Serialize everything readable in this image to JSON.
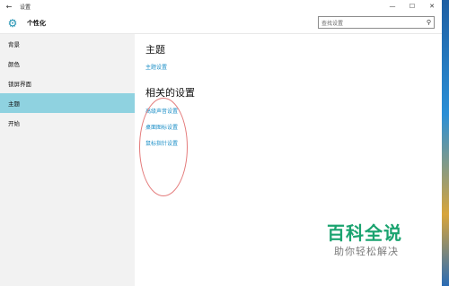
{
  "window": {
    "title": "设置",
    "back_icon": "back-arrow-icon",
    "controls": [
      "minimize-icon",
      "maximize-icon",
      "close-icon"
    ]
  },
  "header": {
    "title": "个性化",
    "icon": "gear-icon",
    "search_placeholder": "查找设置"
  },
  "sidebar": {
    "items": [
      {
        "label": "背景",
        "active": false
      },
      {
        "label": "颜色",
        "active": false
      },
      {
        "label": "锁屏界面",
        "active": false
      },
      {
        "label": "主题",
        "active": true
      },
      {
        "label": "开始",
        "active": false
      }
    ],
    "active_color": "#8fd2e0"
  },
  "main": {
    "theme_heading": "主题",
    "theme_link": "主题设置",
    "related_heading": "相关的设置",
    "related_links": [
      "高级声音设置",
      "桌面图标设置",
      "鼠标指针设置"
    ],
    "link_color": "#1c8fc7"
  },
  "watermark": {
    "main": "百科全说",
    "sub": "助你轻松解决",
    "color": "#1aa36f"
  }
}
